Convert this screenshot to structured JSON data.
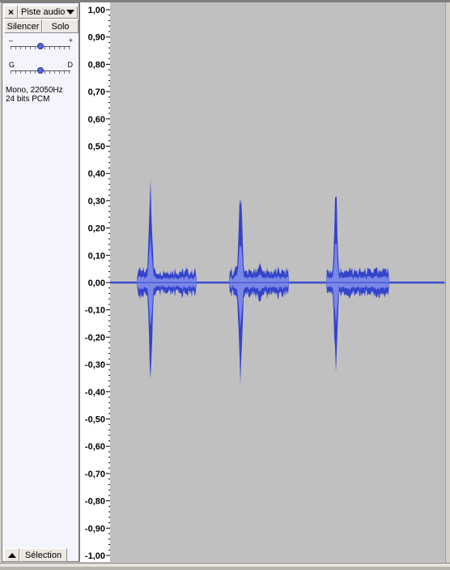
{
  "track": {
    "close_icon": "×",
    "name": "Piste audio",
    "mute_label": "Silencer",
    "solo_label": "Solo",
    "gain": {
      "left": "–",
      "right": "+",
      "value": 0.5
    },
    "pan": {
      "left": "G",
      "right": "D",
      "value": 0.5
    },
    "info_line1": "Mono, 22050Hz",
    "info_line2": "24 bits PCM",
    "select_label": "Sélection"
  },
  "icons": {
    "close": "close-icon",
    "dropdown": "chevron-down-icon",
    "collapse": "triangle-up-icon"
  },
  "ruler": {
    "labels": [
      "1,00",
      "0,90",
      "0,80",
      "0,70",
      "0,60",
      "0,50",
      "0,40",
      "0,30",
      "0,20",
      "0,10",
      "0,00",
      "-0,10",
      "-0,20",
      "-0,30",
      "-0,40",
      "-0,50",
      "-0,60",
      "-0,70",
      "-0,80",
      "-0,90",
      "-1,00"
    ]
  },
  "colors": {
    "panel_bg": "#f4f4fd",
    "wave_bg": "#c0c0c0",
    "wave_outer": "#3344cc",
    "wave_inner": "#7a87e6",
    "ruler_bg": "#ffffff"
  }
}
